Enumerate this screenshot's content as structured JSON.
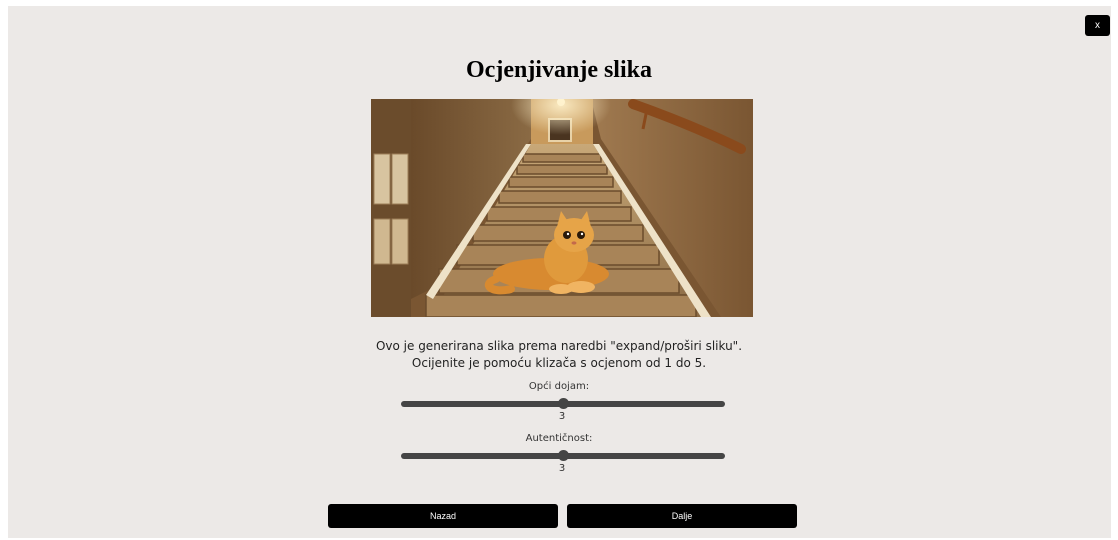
{
  "close_button": {
    "label": "x"
  },
  "title": "Ocjenjivanje slika",
  "image": {
    "subject": "orange kitten lying on carpeted staircase"
  },
  "description": {
    "line1": "Ovo je generirana slika prema naredbi \"expand/proširi sliku\".",
    "line2": "Ocijenite je pomoću klizača s ocjenom od 1 do 5."
  },
  "sliders": [
    {
      "label": "Opći dojam:",
      "value": "3",
      "min": 1,
      "max": 5,
      "current": 3
    },
    {
      "label": "Autentičnost:",
      "value": "3",
      "min": 1,
      "max": 5,
      "current": 3
    }
  ],
  "buttons": {
    "back": "Nazad",
    "next": "Dalje"
  }
}
